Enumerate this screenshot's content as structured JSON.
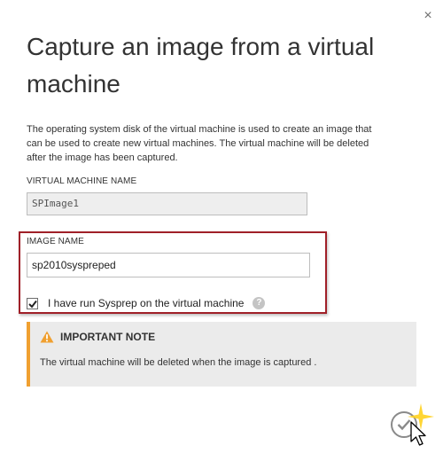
{
  "dialog": {
    "close_glyph": "×",
    "title": "Capture an image from a virtual machine",
    "description": "The operating system disk of the virtual machine is used to create an image that can be used to create new virtual machines. The virtual machine will be deleted after the image has been captured."
  },
  "vm_name": {
    "label": "VIRTUAL MACHINE NAME",
    "value": "SPImage1"
  },
  "image_name": {
    "label": "IMAGE NAME",
    "value": "sp2010syspreped"
  },
  "sysprep": {
    "checked": true,
    "label": "I have run Sysprep on the virtual machine",
    "help_glyph": "?"
  },
  "note": {
    "title": "IMPORTANT NOTE",
    "text": "The virtual machine will be deleted when the image is captured .",
    "icon": "warning-icon"
  },
  "actions": {
    "confirm_icon": "checkmark-icon"
  },
  "colors": {
    "highlight_border": "#a02028",
    "note_accent": "#f0a030",
    "note_background": "#ebebeb"
  }
}
